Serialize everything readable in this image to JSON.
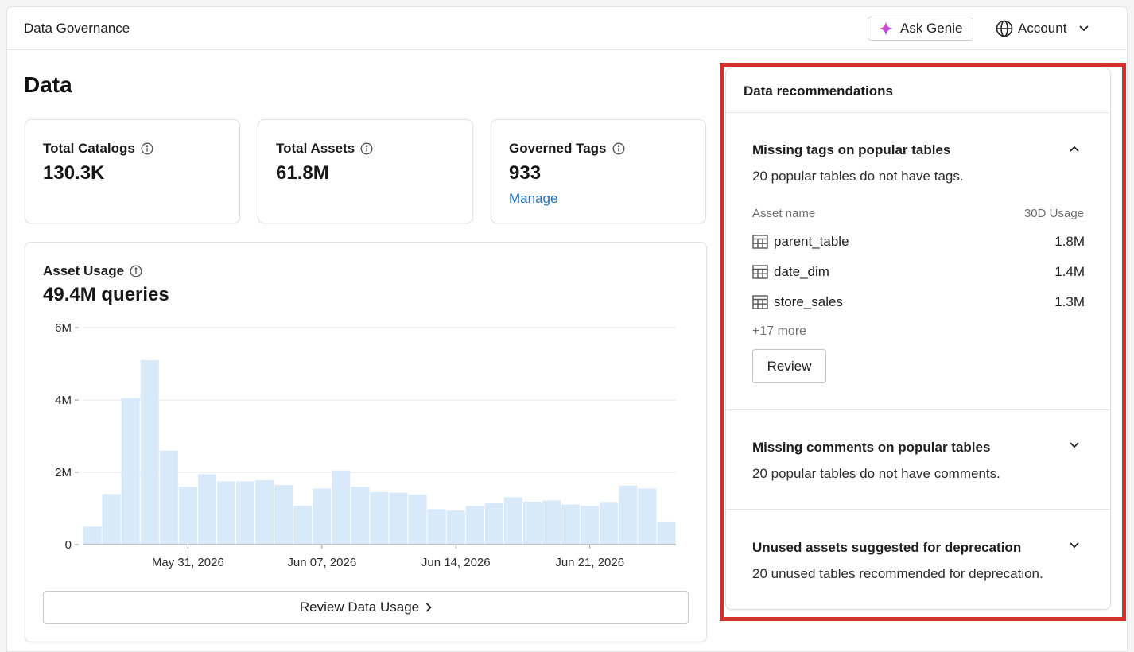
{
  "header": {
    "app_title": "Data Governance",
    "genie_label": "Ask Genie",
    "account_label": "Account"
  },
  "page": {
    "title": "Data"
  },
  "stats": [
    {
      "label": "Total Catalogs",
      "value": "130.3K"
    },
    {
      "label": "Total Assets",
      "value": "61.8M"
    },
    {
      "label": "Governed Tags",
      "value": "933",
      "link": "Manage"
    }
  ],
  "usage": {
    "label": "Asset Usage",
    "value": "49.4M queries",
    "review_button": "Review Data Usage"
  },
  "chart_data": {
    "type": "bar",
    "title": "",
    "xlabel": "",
    "ylabel": "",
    "ylim": [
      0,
      6000000
    ],
    "y_ticks": [
      {
        "value": 0,
        "label": "0"
      },
      {
        "value": 2000000,
        "label": "2M"
      },
      {
        "value": 4000000,
        "label": "4M"
      },
      {
        "value": 6000000,
        "label": "6M"
      }
    ],
    "x_tick_labels": [
      {
        "index": 5,
        "label": "May 31, 2026"
      },
      {
        "index": 12,
        "label": "Jun 07, 2026"
      },
      {
        "index": 19,
        "label": "Jun 14, 2026"
      },
      {
        "index": 26,
        "label": "Jun 21, 2026"
      }
    ],
    "values": [
      500000,
      1400000,
      4050000,
      5100000,
      2600000,
      1600000,
      1950000,
      1750000,
      1750000,
      1780000,
      1650000,
      1080000,
      1550000,
      2050000,
      1600000,
      1450000,
      1440000,
      1380000,
      980000,
      940000,
      1070000,
      1160000,
      1310000,
      1190000,
      1220000,
      1110000,
      1070000,
      1180000,
      1630000,
      1550000,
      640000
    ],
    "grid": true,
    "legend": "none",
    "bar_color": "#d8e9fa"
  },
  "recommendations": {
    "title": "Data recommendations",
    "sections": [
      {
        "title": "Missing tags on popular tables",
        "description": "20 popular tables do not have tags.",
        "expanded": true,
        "col_asset": "Asset name",
        "col_usage": "30D Usage",
        "rows": [
          {
            "name": "parent_table",
            "usage": "1.8M"
          },
          {
            "name": "date_dim",
            "usage": "1.4M"
          },
          {
            "name": "store_sales",
            "usage": "1.3M"
          }
        ],
        "more": "+17 more",
        "button": "Review"
      },
      {
        "title": "Missing comments on popular tables",
        "description": "20 popular tables do not have comments.",
        "expanded": false
      },
      {
        "title": "Unused assets suggested for deprecation",
        "description": "20 unused tables recommended for deprecation.",
        "expanded": false
      }
    ]
  },
  "colors": {
    "highlight": "#d3302b",
    "link": "#2272b4",
    "bar": "#d8e9fa"
  }
}
